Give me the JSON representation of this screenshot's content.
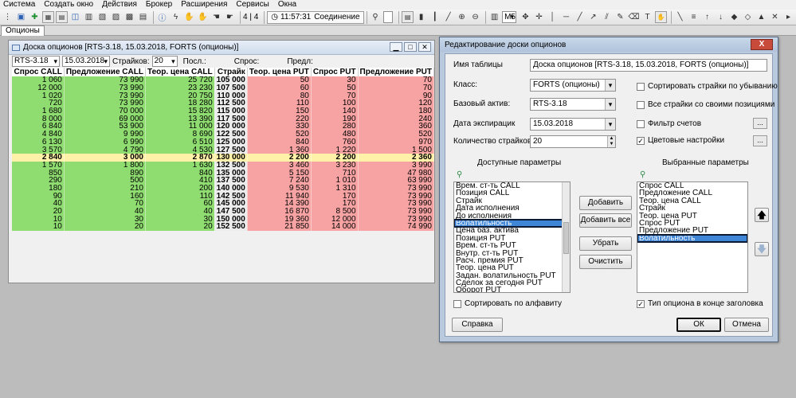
{
  "menu": [
    "Система",
    "Создать окно",
    "Действия",
    "Брокер",
    "Расширения",
    "Сервисы",
    "Окна"
  ],
  "toolbar": {
    "pos_text": "4 | 4",
    "clock": "11:57:31",
    "connection": "Соединение",
    "interval": "M5"
  },
  "tab": {
    "label": "Опционы"
  },
  "board": {
    "title": "Доска опционов [RTS-3.18, 15.03.2018, FORTS (опционы)]",
    "filters": {
      "asset": "RTS-3.18",
      "date": "15.03.2018",
      "strikes_label": "Страйков:",
      "strikes": "20",
      "last_label": "Посл.:",
      "bid_label": "Спрос:",
      "ask_label": "Предл:"
    },
    "columns": [
      "Спрос CALL",
      "Предложение CALL",
      "Теор. цена CALL",
      "Страйк",
      "Теор. цена PUT",
      "Спрос PUT",
      "Предложение PUT"
    ],
    "rows": [
      [
        "1 060",
        "73 990",
        "25 720",
        "105 000",
        "50",
        "30",
        "70"
      ],
      [
        "12 000",
        "73 990",
        "23 230",
        "107 500",
        "60",
        "50",
        "70"
      ],
      [
        "1 020",
        "73 990",
        "20 750",
        "110 000",
        "80",
        "70",
        "90"
      ],
      [
        "720",
        "73 990",
        "18 280",
        "112 500",
        "110",
        "100",
        "120"
      ],
      [
        "1 680",
        "70 000",
        "15 820",
        "115 000",
        "150",
        "140",
        "180"
      ],
      [
        "8 000",
        "69 000",
        "13 390",
        "117 500",
        "220",
        "190",
        "240"
      ],
      [
        "6 840",
        "53 900",
        "11 000",
        "120 000",
        "330",
        "280",
        "360"
      ],
      [
        "4 840",
        "9 990",
        "8 690",
        "122 500",
        "520",
        "480",
        "520"
      ],
      [
        "6 130",
        "6 990",
        "6 510",
        "125 000",
        "840",
        "760",
        "970"
      ],
      [
        "3 570",
        "4 790",
        "4 530",
        "127 500",
        "1 360",
        "1 220",
        "1 500"
      ],
      [
        "2 840",
        "3 000",
        "2 870",
        "130 000",
        "2 200",
        "2 200",
        "2 360"
      ],
      [
        "1 570",
        "1 800",
        "1 630",
        "132 500",
        "3 460",
        "3 230",
        "3 990"
      ],
      [
        "850",
        "890",
        "840",
        "135 000",
        "5 150",
        "710",
        "47 980"
      ],
      [
        "290",
        "500",
        "410",
        "137 500",
        "7 240",
        "1 010",
        "63 990"
      ],
      [
        "180",
        "210",
        "200",
        "140 000",
        "9 530",
        "1 310",
        "73 990"
      ],
      [
        "90",
        "160",
        "110",
        "142 500",
        "11 940",
        "170",
        "73 990"
      ],
      [
        "40",
        "70",
        "60",
        "145 000",
        "14 390",
        "170",
        "73 990"
      ],
      [
        "20",
        "40",
        "40",
        "147 500",
        "16 870",
        "8 500",
        "73 990"
      ],
      [
        "10",
        "30",
        "30",
        "150 000",
        "19 360",
        "12 000",
        "73 990"
      ],
      [
        "10",
        "20",
        "20",
        "152 500",
        "21 850",
        "14 000",
        "74 990"
      ]
    ],
    "atm_row": 10
  },
  "dialog": {
    "title": "Редактирование доски опционов",
    "close": "X",
    "table_name_label": "Имя таблицы",
    "table_name": "Доска опционов [RTS-3.18, 15.03.2018, FORTS (опционы)]",
    "class_label": "Класс:",
    "class_value": "FORTS (опционы)",
    "base_label": "Базовый актив:",
    "base_value": "RTS-3.18",
    "exp_label": "Дата экспирацик",
    "exp_value": "15.03.2018",
    "strikes_label": "Количество страйков:",
    "strikes_value": "20",
    "sort_desc": "Сортировать страйки по убыванию",
    "all_strikes": "Все страйки со своими позициями",
    "account_filter": "Фильтр счетов",
    "color_settings": "Цветовые настройки",
    "dots": "...",
    "available_header": "Доступные параметры",
    "selected_header": "Выбранные параметры",
    "available": [
      "Врем. ст-ть CALL",
      "Позиция CALL",
      "Страйк",
      "Дата исполнения",
      "До исполнения",
      "Волатильность",
      "Цена баз. актива",
      "Позиция PUT",
      "Врем. ст-ть PUT",
      "Внутр. ст-ть PUT",
      "Расч. премия PUT",
      "Теор. цена PUT",
      "Задан. волатильность PUT",
      "Сделок за сегодня PUT",
      "Оборот PUT"
    ],
    "available_selected": 5,
    "selected": [
      "Спрос CALL",
      "Предложение CALL",
      "Теор. цена CALL",
      "Страйк",
      "Теор. цена PUT",
      "Спрос PUT",
      "Предложение PUT",
      "Волатильность"
    ],
    "selected_selected": 7,
    "btn_add": "Добавить",
    "btn_add_all": "Добавить все",
    "btn_remove": "Убрать",
    "btn_clear": "Очистить",
    "sort_alpha": "Сортировать по алфавиту",
    "option_type_end": "Тип опциона в конце заголовка",
    "help": "Справка",
    "ok": "ОК",
    "cancel": "Отмена"
  }
}
